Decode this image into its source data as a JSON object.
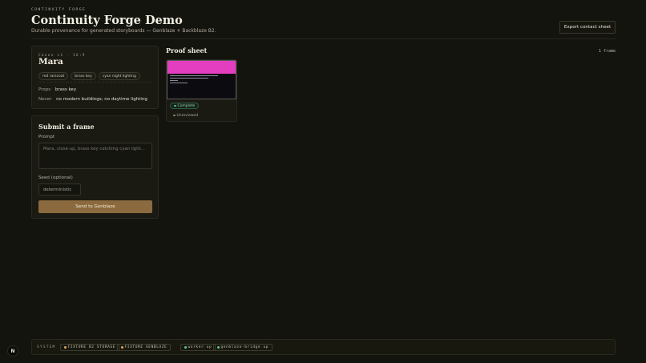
{
  "header": {
    "eyebrow": "Continuity Forge",
    "title": "Continuity Forge Demo",
    "subtitle": "Durable provenance for generated storyboards — Genblaze + Backblaze B2.",
    "export_label": "Export contact sheet"
  },
  "canon": {
    "eyebrow": "Canon v1 · 16:9",
    "name": "Mara",
    "chips": [
      "red raincoat",
      "brass key",
      "cyan night lighting"
    ],
    "props_label": "Props",
    "props_value": "brass key",
    "never_label": "Never",
    "never_value": "no modern buildings; no daytime lighting"
  },
  "submit": {
    "title": "Submit a frame",
    "prompt_label": "Prompt",
    "prompt_placeholder": "Mara, close-up, brass key catching cyan light...",
    "seed_label": "Seed (optional)",
    "seed_placeholder": "deterministic",
    "send_label": "Send to Genblaze"
  },
  "proof": {
    "title": "Proof sheet",
    "count": "1 frame",
    "frames": [
      {
        "status": "Complete",
        "review": "Unreviewed"
      }
    ]
  },
  "system": {
    "label": "System",
    "chips": [
      "Fixture B2 storage",
      "Fixture Genblaze"
    ],
    "services": [
      "worker up",
      "genblaze-bridge up"
    ]
  },
  "logo_text": "N",
  "colors": {
    "accent": "#8a6a3e",
    "complete": "#5fbf86",
    "fixture": "#d9a25a",
    "service_up": "#5fbf86",
    "thumb_magenta": "#e33dc0"
  }
}
